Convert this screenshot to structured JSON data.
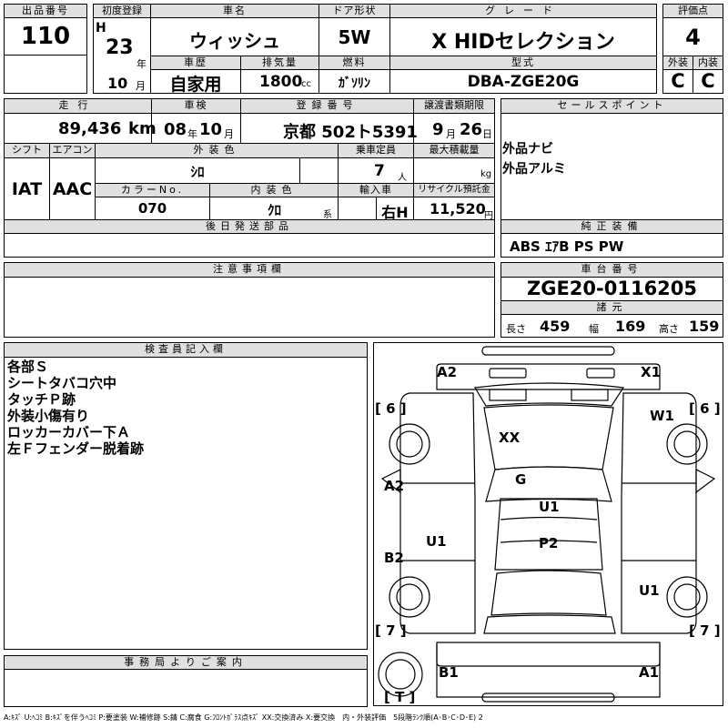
{
  "lot": {
    "label": "出品番号",
    "value": "110"
  },
  "first_reg": {
    "label": "初度登録",
    "era": "H",
    "year": "23",
    "year_unit": "年",
    "month": "10",
    "month_unit": "月"
  },
  "car_name": {
    "label": "車名",
    "value": "ウィッシュ"
  },
  "door": {
    "label": "ドア形状",
    "value": "5W"
  },
  "grade": {
    "label": "グレード",
    "value": "X HIDセレクション"
  },
  "score": {
    "label": "評価点",
    "value": "4"
  },
  "history": {
    "label": "車歴",
    "value": "自家用"
  },
  "displacement": {
    "label": "排気量",
    "value": "1800",
    "unit": "cc"
  },
  "fuel": {
    "label": "燃料",
    "value": "ｶﾞｿﾘﾝ"
  },
  "model": {
    "label": "型式",
    "value": "DBA-ZGE20G"
  },
  "exterior_grade": {
    "label": "外装",
    "value": "C"
  },
  "interior_grade": {
    "label": "内装",
    "value": "C"
  },
  "mileage": {
    "label": "走行",
    "value": "89,436",
    "unit": "km"
  },
  "inspection": {
    "label": "車検",
    "year": "08",
    "year_unit": "年",
    "month": "10",
    "month_unit": "月"
  },
  "reg_number": {
    "label": "登録番号",
    "value": "京都 502ト5391"
  },
  "transfer": {
    "label": "譲渡書類期限",
    "month": "9",
    "month_unit": "月",
    "day": "26",
    "day_unit": "日"
  },
  "sales_point": {
    "label": "セールスポイント",
    "items": [
      "外品ナビ",
      "外品アルミ"
    ]
  },
  "shift": {
    "label": "シフト",
    "value": "IAT"
  },
  "aircon": {
    "label": "エアコン",
    "value": "AAC"
  },
  "ext_color": {
    "label": "外装色",
    "value": "ｼﾛ"
  },
  "capacity": {
    "label": "乗車定員",
    "value": "7",
    "unit": "人"
  },
  "max_load": {
    "label": "最大積載量",
    "value": "",
    "unit": "kg"
  },
  "color_no": {
    "label": "カラーNo.",
    "value": "070"
  },
  "int_color": {
    "label": "内装色",
    "value": "ｸﾛ",
    "unit": "系"
  },
  "import": {
    "label": "輸入車",
    "value": "右H"
  },
  "recycle": {
    "label": "リサイクル預託金",
    "value": "11,520",
    "unit": "円"
  },
  "later_parts": {
    "label": "後日発送部品",
    "value": ""
  },
  "equipment": {
    "label": "純正装備",
    "value": "ABS ｴｱB PS PW"
  },
  "caution": {
    "label": "注意事項欄",
    "value": ""
  },
  "chassis": {
    "label": "車台番号",
    "value": "ZGE20-0116205"
  },
  "specs": {
    "label": "諸元",
    "length_label": "長さ",
    "length": "459",
    "width_label": "幅",
    "width": "169",
    "height_label": "高さ",
    "height": "159"
  },
  "inspector": {
    "label": "検査員記入欄",
    "lines": [
      "各部Ｓ",
      "シートタバコ穴中",
      "タッチＰ跡",
      "外装小傷有り",
      "ロッカーカバー下Ａ",
      "左Ｆフェンダー脱着跡"
    ]
  },
  "office": {
    "label": "事務局よりご案内",
    "value": ""
  },
  "diagram": {
    "marks": [
      "A2",
      "X1",
      "W1",
      "XX",
      "G",
      "A2",
      "U1",
      "U1",
      "P2",
      "B2",
      "U1",
      "B1",
      "A1"
    ],
    "brackets": [
      "[ 6 ]",
      "[ 6 ]",
      "[ 7 ]",
      "[ 7 ]",
      "[ T ]"
    ]
  },
  "legend": "A:ｷｽﾞ U:ﾍｺﾐ B:ｷｽﾞを伴うﾍｺﾐ P:要塗装 W:補修跡 S:錆 C:腐食 G:ﾌﾛﾝﾄｶﾞﾗｽ点ｷｽﾞ XX:交換済み X:要交換　内・外装評価　5段階ﾗﾝｸ順(A･B･C･D･E) 2"
}
